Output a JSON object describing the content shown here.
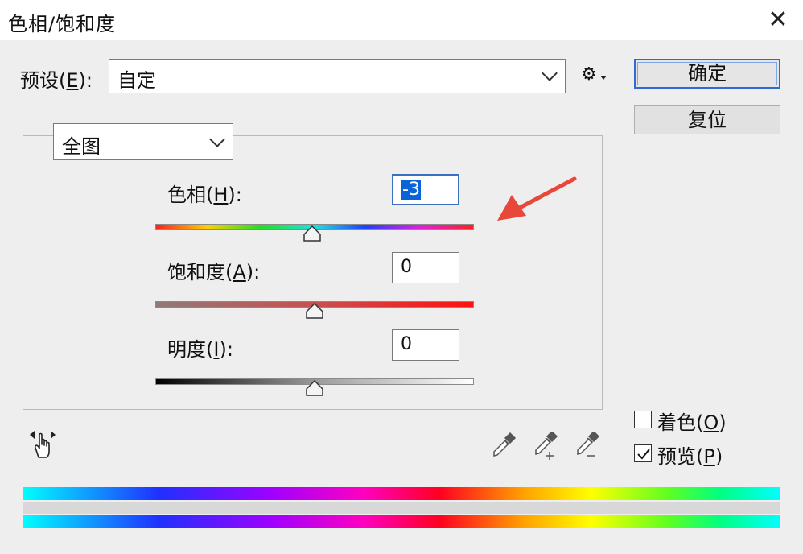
{
  "window": {
    "title": "色相/饱和度",
    "close_glyph": "✕"
  },
  "preset": {
    "label_pre": "预设(",
    "label_key": "E",
    "label_post": "):",
    "value": "自定",
    "settings_glyph": "⚙"
  },
  "buttons": {
    "ok": "确定",
    "reset": "复位"
  },
  "channel": {
    "value": "全图"
  },
  "hue": {
    "label_pre": "色相(",
    "label_key": "H",
    "label_post": "):",
    "value": "-3",
    "level": 0.4924
  },
  "saturation": {
    "label_pre": "饱和度(",
    "label_key": "A",
    "label_post": "):",
    "value": "0",
    "level": 0.5
  },
  "lightness": {
    "label_pre": "明度(",
    "label_key": "I",
    "label_post": "):",
    "value": "0",
    "level": 0.5
  },
  "options": {
    "colorize": {
      "label_pre": "着色(",
      "label_key": "O",
      "label_post": ")",
      "checked": false
    },
    "preview": {
      "label_pre": "预览(",
      "label_key": "P",
      "label_post": ")",
      "checked": true
    }
  },
  "colors": {
    "accent": "#2f6bd1",
    "annotation_arrow": "#e8473a"
  }
}
